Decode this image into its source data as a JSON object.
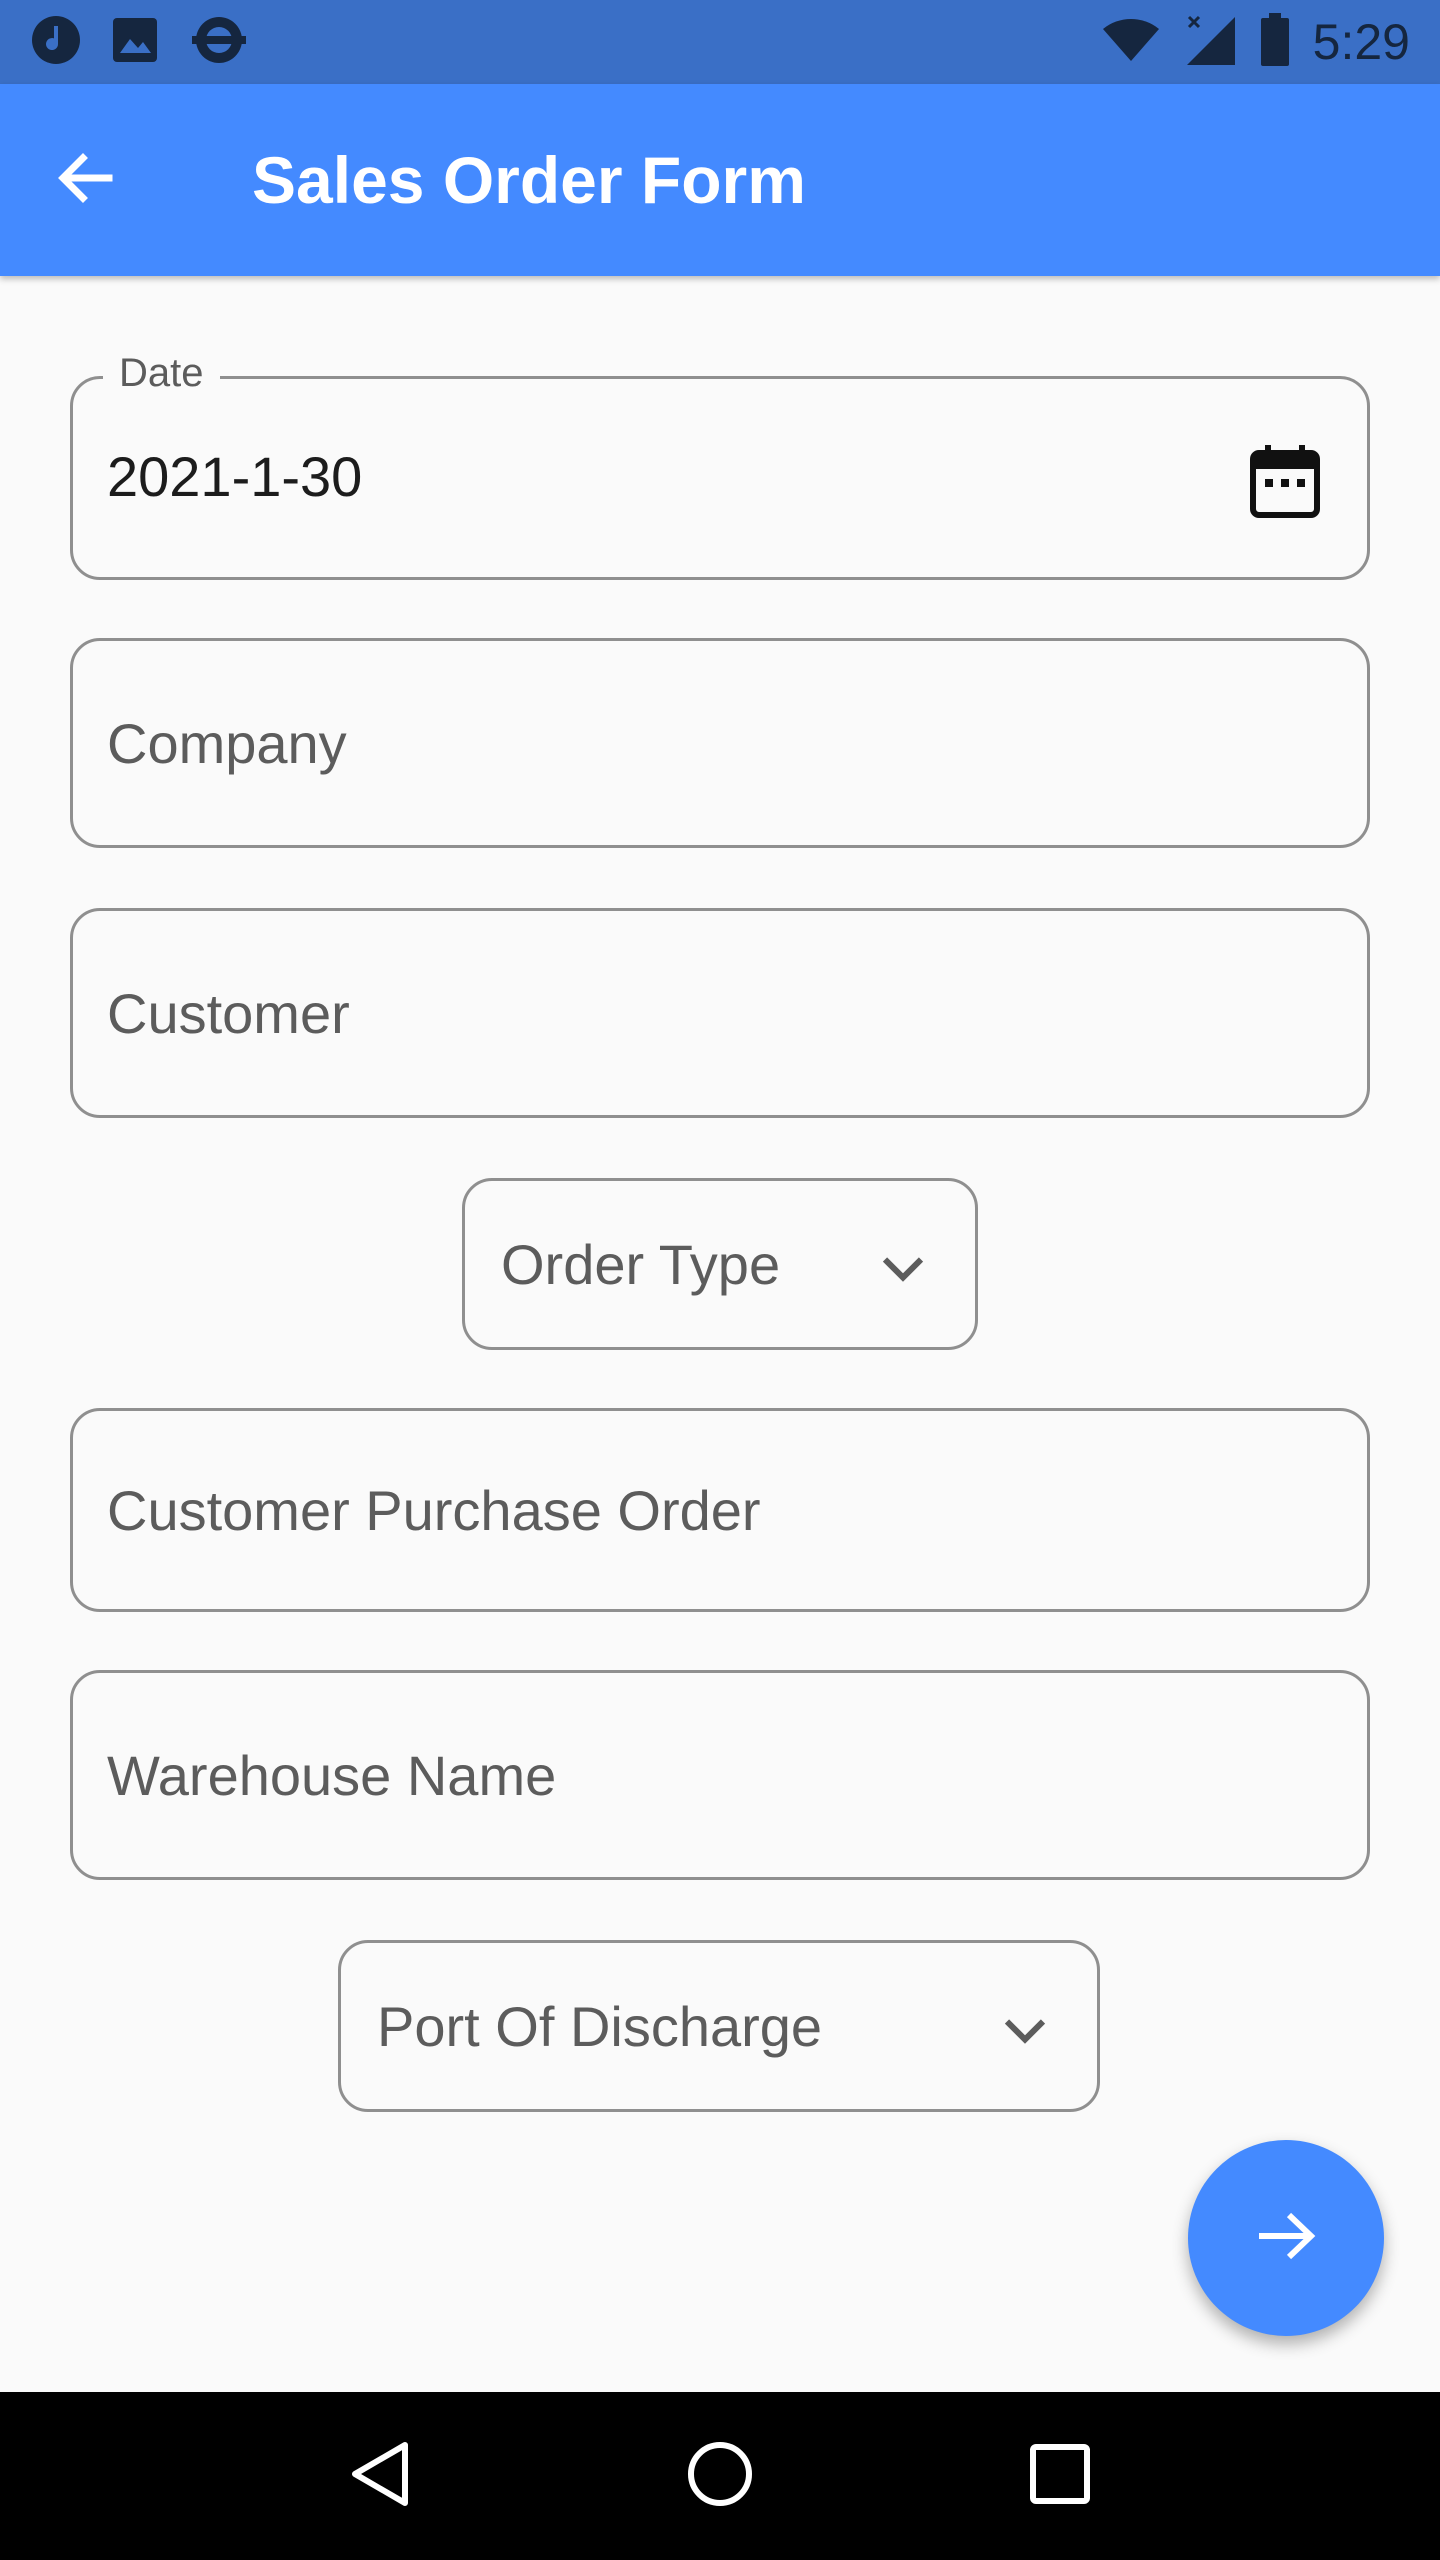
{
  "status_bar": {
    "time": "5:29",
    "icons_left": [
      "music-note-icon",
      "image-icon",
      "transit-icon"
    ],
    "icons_right": [
      "wifi-icon",
      "signal-icon",
      "battery-icon"
    ]
  },
  "app_bar": {
    "title": "Sales Order Form",
    "back_icon": "arrow-back-icon"
  },
  "form": {
    "date": {
      "label": "Date",
      "value": "2021-1-30",
      "icon": "calendar-icon"
    },
    "company": {
      "placeholder": "Company"
    },
    "customer": {
      "placeholder": "Customer"
    },
    "order_type": {
      "placeholder": "Order Type",
      "icon": "chevron-down-icon"
    },
    "customer_po": {
      "placeholder": "Customer Purchase Order"
    },
    "warehouse": {
      "placeholder": "Warehouse Name"
    },
    "port_of_discharge": {
      "placeholder": "Port Of Discharge",
      "icon": "chevron-down-icon"
    }
  },
  "fab": {
    "icon": "arrow-forward-icon"
  },
  "nav_bar": {
    "icons": [
      "back-triangle-icon",
      "home-circle-icon",
      "recents-square-icon"
    ]
  },
  "colors": {
    "primary": "#448aff",
    "status_bar": "#3a6fc6",
    "background": "#fafafa"
  }
}
